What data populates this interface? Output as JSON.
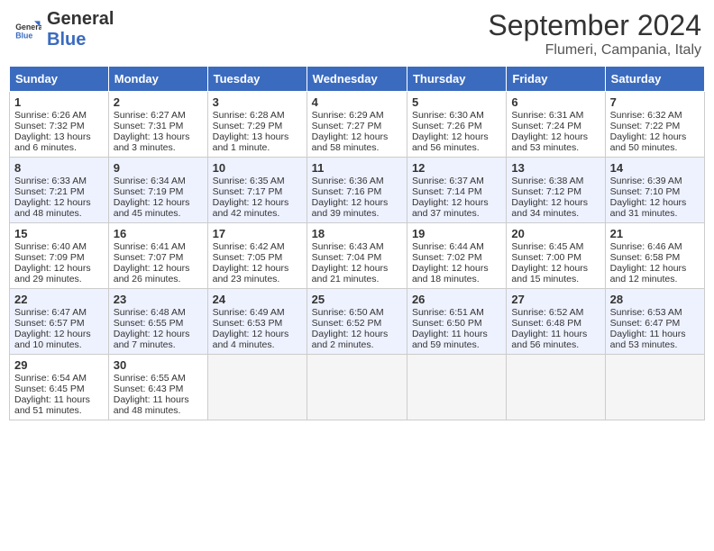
{
  "header": {
    "logo_line1": "General",
    "logo_line2": "Blue",
    "month_title": "September 2024",
    "location": "Flumeri, Campania, Italy"
  },
  "days_of_week": [
    "Sunday",
    "Monday",
    "Tuesday",
    "Wednesday",
    "Thursday",
    "Friday",
    "Saturday"
  ],
  "weeks": [
    [
      {
        "day": "1",
        "sunrise": "6:26 AM",
        "sunset": "7:32 PM",
        "daylight": "13 hours and 6 minutes."
      },
      {
        "day": "2",
        "sunrise": "6:27 AM",
        "sunset": "7:31 PM",
        "daylight": "13 hours and 3 minutes."
      },
      {
        "day": "3",
        "sunrise": "6:28 AM",
        "sunset": "7:29 PM",
        "daylight": "13 hours and 1 minute."
      },
      {
        "day": "4",
        "sunrise": "6:29 AM",
        "sunset": "7:27 PM",
        "daylight": "12 hours and 58 minutes."
      },
      {
        "day": "5",
        "sunrise": "6:30 AM",
        "sunset": "7:26 PM",
        "daylight": "12 hours and 56 minutes."
      },
      {
        "day": "6",
        "sunrise": "6:31 AM",
        "sunset": "7:24 PM",
        "daylight": "12 hours and 53 minutes."
      },
      {
        "day": "7",
        "sunrise": "6:32 AM",
        "sunset": "7:22 PM",
        "daylight": "12 hours and 50 minutes."
      }
    ],
    [
      {
        "day": "8",
        "sunrise": "6:33 AM",
        "sunset": "7:21 PM",
        "daylight": "12 hours and 48 minutes."
      },
      {
        "day": "9",
        "sunrise": "6:34 AM",
        "sunset": "7:19 PM",
        "daylight": "12 hours and 45 minutes."
      },
      {
        "day": "10",
        "sunrise": "6:35 AM",
        "sunset": "7:17 PM",
        "daylight": "12 hours and 42 minutes."
      },
      {
        "day": "11",
        "sunrise": "6:36 AM",
        "sunset": "7:16 PM",
        "daylight": "12 hours and 39 minutes."
      },
      {
        "day": "12",
        "sunrise": "6:37 AM",
        "sunset": "7:14 PM",
        "daylight": "12 hours and 37 minutes."
      },
      {
        "day": "13",
        "sunrise": "6:38 AM",
        "sunset": "7:12 PM",
        "daylight": "12 hours and 34 minutes."
      },
      {
        "day": "14",
        "sunrise": "6:39 AM",
        "sunset": "7:10 PM",
        "daylight": "12 hours and 31 minutes."
      }
    ],
    [
      {
        "day": "15",
        "sunrise": "6:40 AM",
        "sunset": "7:09 PM",
        "daylight": "12 hours and 29 minutes."
      },
      {
        "day": "16",
        "sunrise": "6:41 AM",
        "sunset": "7:07 PM",
        "daylight": "12 hours and 26 minutes."
      },
      {
        "day": "17",
        "sunrise": "6:42 AM",
        "sunset": "7:05 PM",
        "daylight": "12 hours and 23 minutes."
      },
      {
        "day": "18",
        "sunrise": "6:43 AM",
        "sunset": "7:04 PM",
        "daylight": "12 hours and 21 minutes."
      },
      {
        "day": "19",
        "sunrise": "6:44 AM",
        "sunset": "7:02 PM",
        "daylight": "12 hours and 18 minutes."
      },
      {
        "day": "20",
        "sunrise": "6:45 AM",
        "sunset": "7:00 PM",
        "daylight": "12 hours and 15 minutes."
      },
      {
        "day": "21",
        "sunrise": "6:46 AM",
        "sunset": "6:58 PM",
        "daylight": "12 hours and 12 minutes."
      }
    ],
    [
      {
        "day": "22",
        "sunrise": "6:47 AM",
        "sunset": "6:57 PM",
        "daylight": "12 hours and 10 minutes."
      },
      {
        "day": "23",
        "sunrise": "6:48 AM",
        "sunset": "6:55 PM",
        "daylight": "12 hours and 7 minutes."
      },
      {
        "day": "24",
        "sunrise": "6:49 AM",
        "sunset": "6:53 PM",
        "daylight": "12 hours and 4 minutes."
      },
      {
        "day": "25",
        "sunrise": "6:50 AM",
        "sunset": "6:52 PM",
        "daylight": "12 hours and 2 minutes."
      },
      {
        "day": "26",
        "sunrise": "6:51 AM",
        "sunset": "6:50 PM",
        "daylight": "11 hours and 59 minutes."
      },
      {
        "day": "27",
        "sunrise": "6:52 AM",
        "sunset": "6:48 PM",
        "daylight": "11 hours and 56 minutes."
      },
      {
        "day": "28",
        "sunrise": "6:53 AM",
        "sunset": "6:47 PM",
        "daylight": "11 hours and 53 minutes."
      }
    ],
    [
      {
        "day": "29",
        "sunrise": "6:54 AM",
        "sunset": "6:45 PM",
        "daylight": "11 hours and 51 minutes."
      },
      {
        "day": "30",
        "sunrise": "6:55 AM",
        "sunset": "6:43 PM",
        "daylight": "11 hours and 48 minutes."
      },
      null,
      null,
      null,
      null,
      null
    ]
  ]
}
